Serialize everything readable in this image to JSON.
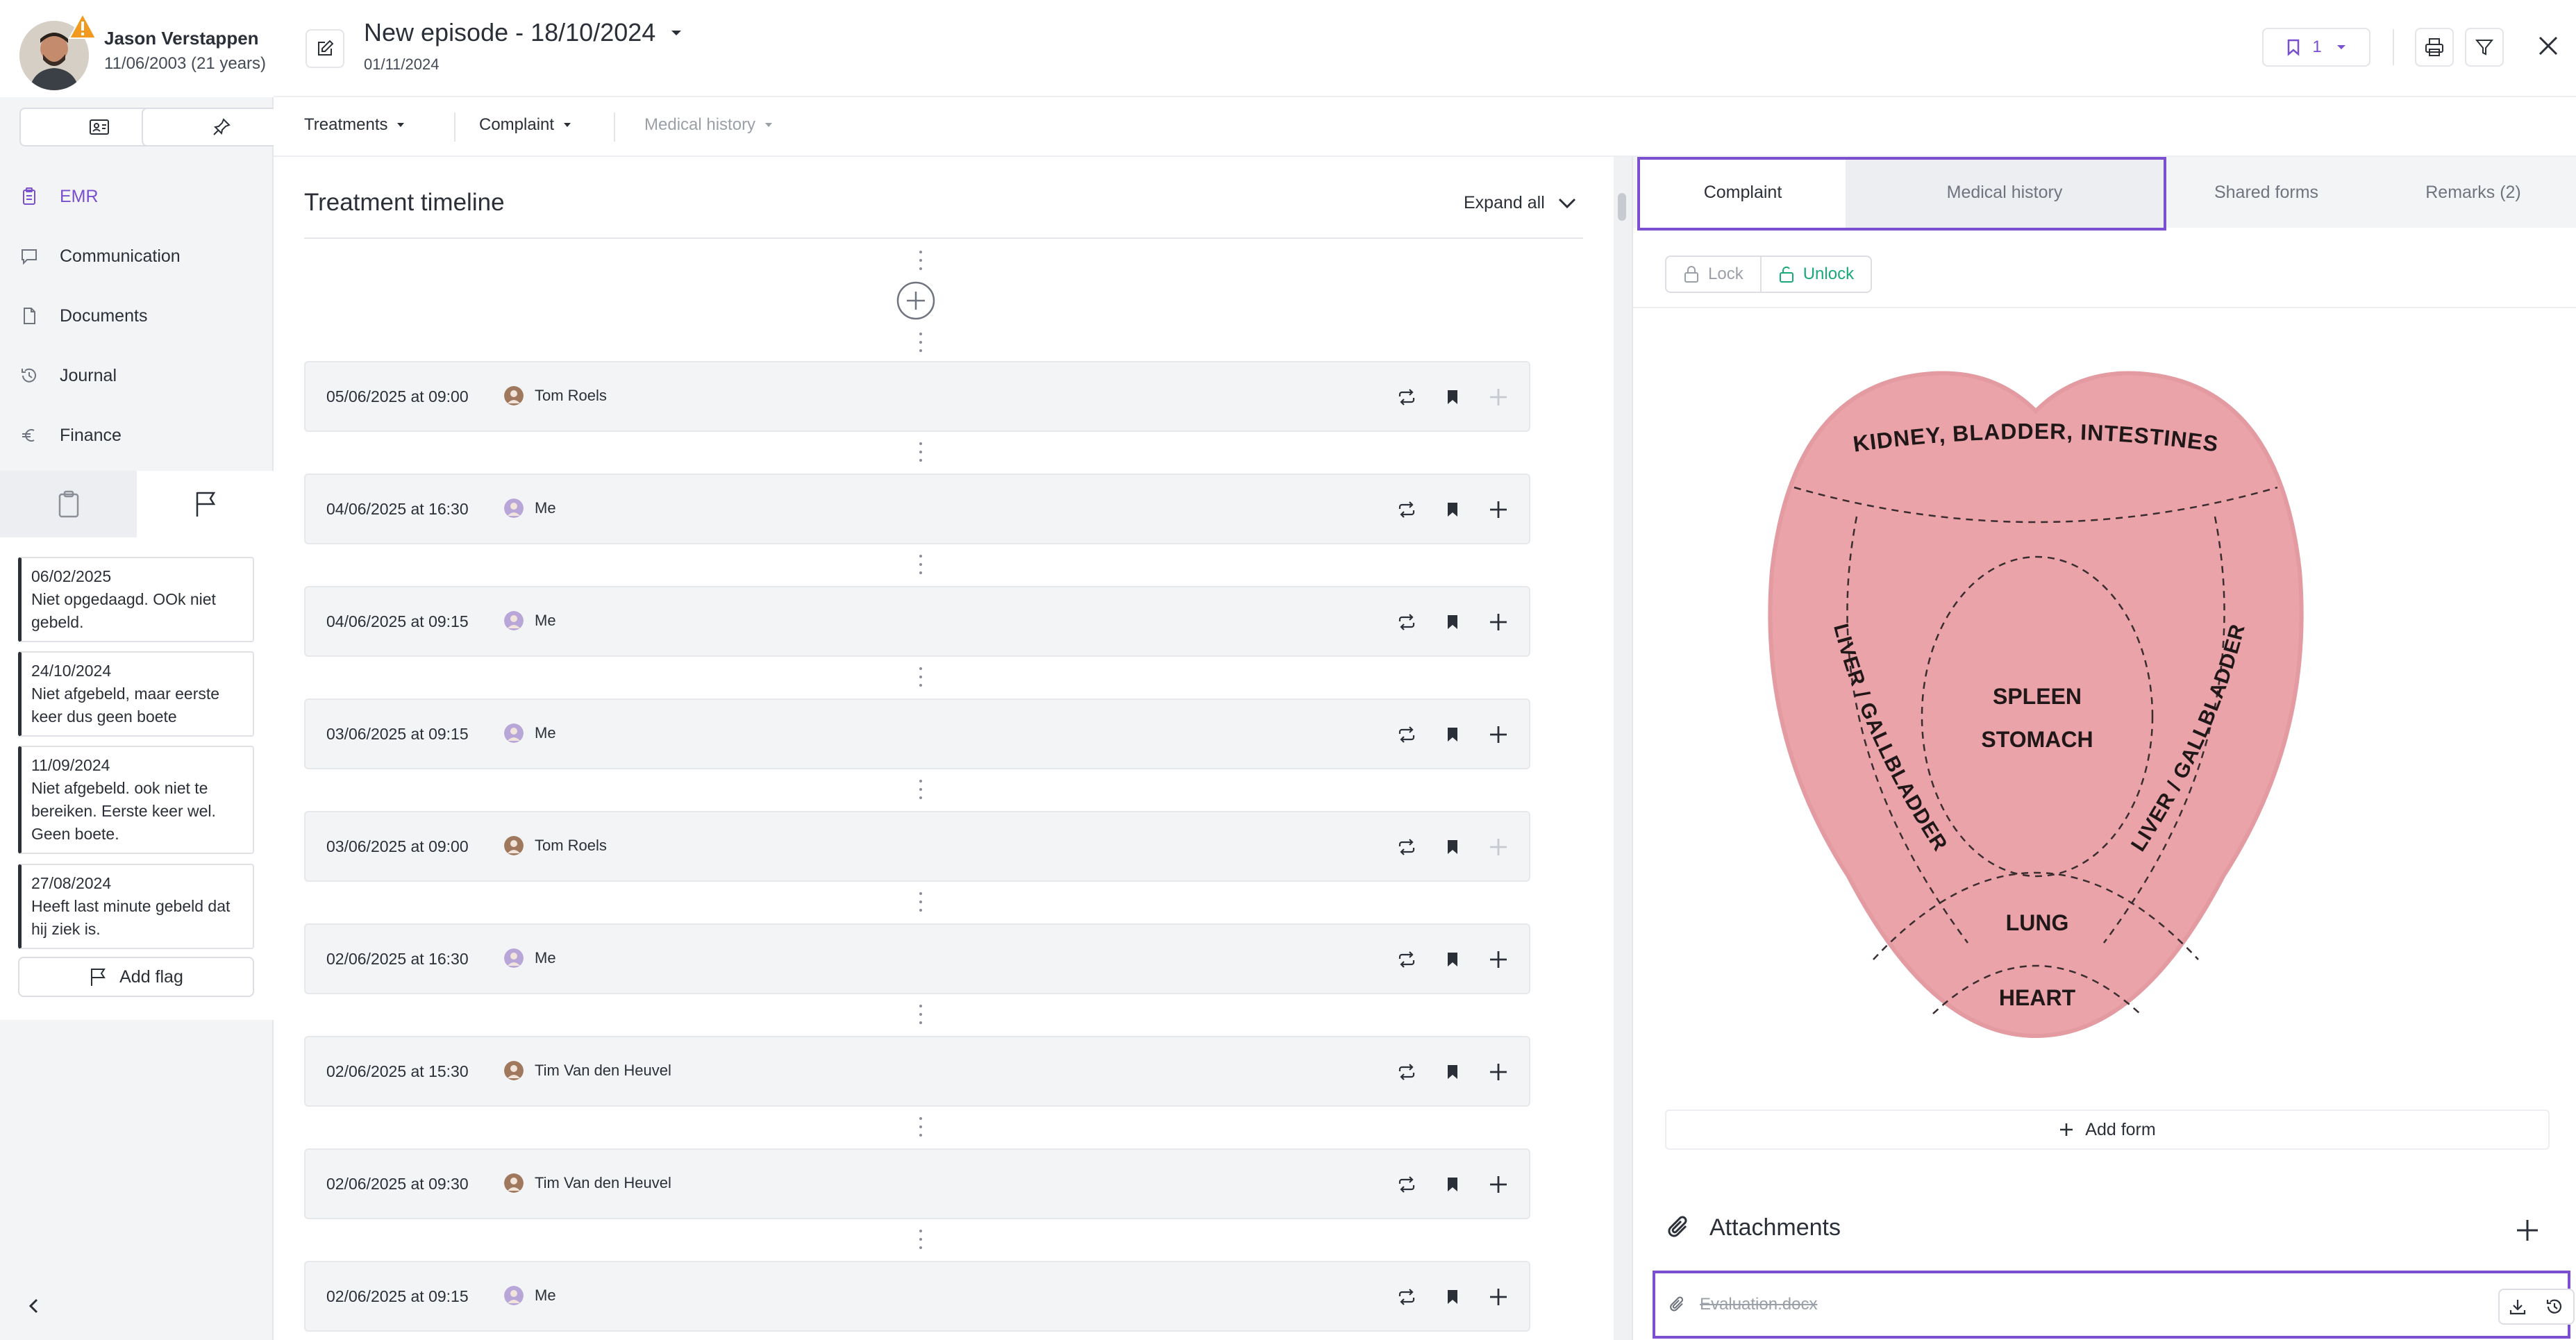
{
  "patient": {
    "name": "Jason Verstappen",
    "dob": "11/06/2003 (21 years)"
  },
  "nav": {
    "items": [
      {
        "label": "EMR",
        "icon": "clipboard-icon"
      },
      {
        "label": "Communication",
        "icon": "chat-icon"
      },
      {
        "label": "Documents",
        "icon": "document-icon"
      },
      {
        "label": "Journal",
        "icon": "history-icon"
      },
      {
        "label": "Finance",
        "icon": "euro-icon"
      }
    ]
  },
  "flags": [
    {
      "date": "06/02/2025",
      "text": "Niet opgedaagd. OOk niet gebeld."
    },
    {
      "date": "24/10/2024",
      "text": "Niet afgebeld, maar eerste keer dus geen boete"
    },
    {
      "date": "11/09/2024",
      "text": "Niet afgebeld. ook niet te bereiken. Eerste keer wel. Geen boete."
    },
    {
      "date": "27/08/2024",
      "text": "Heeft last minute gebeld dat hij ziek is."
    }
  ],
  "add_flag_label": "Add flag",
  "header": {
    "title": "New episode - 18/10/2024",
    "date": "01/11/2024",
    "bookmark_count": "1"
  },
  "filters": {
    "treatments": "Treatments",
    "complaint": "Complaint",
    "medical_history": "Medical history"
  },
  "timeline": {
    "title": "Treatment timeline",
    "expand_all": "Expand all",
    "rows": [
      {
        "date": "05/06/2025 at 09:00",
        "user": "Tom Roels",
        "add_enabled": false
      },
      {
        "date": "04/06/2025 at 16:30",
        "user": "Me",
        "add_enabled": true
      },
      {
        "date": "04/06/2025 at 09:15",
        "user": "Me",
        "add_enabled": true
      },
      {
        "date": "03/06/2025 at 09:15",
        "user": "Me",
        "add_enabled": true
      },
      {
        "date": "03/06/2025 at 09:00",
        "user": "Tom Roels",
        "add_enabled": false
      },
      {
        "date": "02/06/2025 at 16:30",
        "user": "Me",
        "add_enabled": true
      },
      {
        "date": "02/06/2025 at 15:30",
        "user": "Tim Van den Heuvel",
        "add_enabled": true
      },
      {
        "date": "02/06/2025 at 09:30",
        "user": "Tim Van den Heuvel",
        "add_enabled": true
      },
      {
        "date": "02/06/2025 at 09:15",
        "user": "Me",
        "add_enabled": true
      }
    ]
  },
  "right_panel": {
    "tabs": [
      "Complaint",
      "Medical history",
      "Shared forms",
      "Remarks (2)"
    ],
    "lock_label": "Lock",
    "unlock_label": "Unlock",
    "diagram_labels": {
      "top": "KIDNEY, BLADDER, INTESTINES",
      "left": "LIVER / GALLBLADDER",
      "right": "LIVER / GALLBLADDER",
      "center1": "SPLEEN",
      "center2": "STOMACH",
      "lung": "LUNG",
      "heart": "HEART"
    },
    "add_form_label": "Add form",
    "attachments_title": "Attachments",
    "attachment_file": "Evaluation.docx"
  },
  "colors": {
    "accent": "#7a4fd0",
    "unlock": "#1aa97b",
    "tongue_fill": "#eaa3a8"
  }
}
